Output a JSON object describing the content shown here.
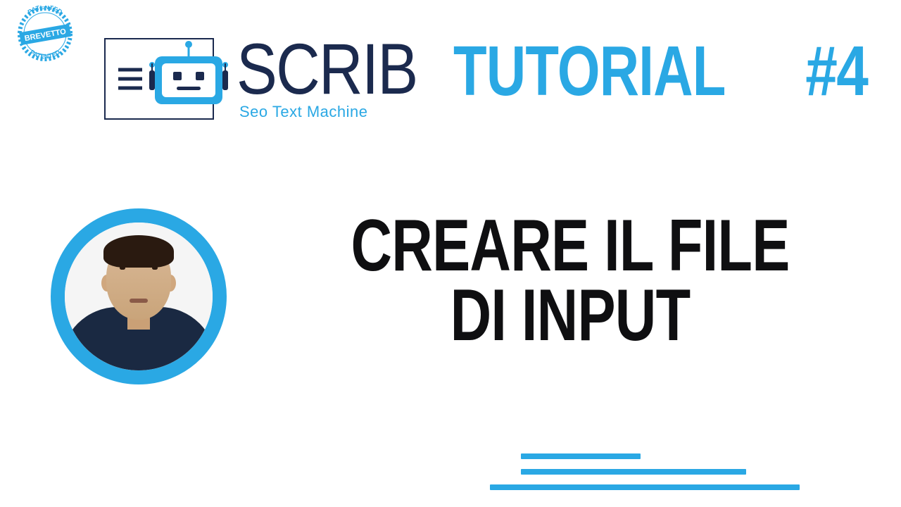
{
  "badge": {
    "text": "BREVETTO",
    "arc": "PATENTED"
  },
  "logo": {
    "name": "SCRIB",
    "tagline": "Seo Text Machine"
  },
  "header": {
    "label": "TUTORIAL",
    "number": "#4"
  },
  "title": {
    "line1": "CREARE IL FILE",
    "line2": "DI INPUT"
  },
  "colors": {
    "accent": "#2aa8e4",
    "dark": "#1b2a4e",
    "black": "#0f0f11"
  }
}
